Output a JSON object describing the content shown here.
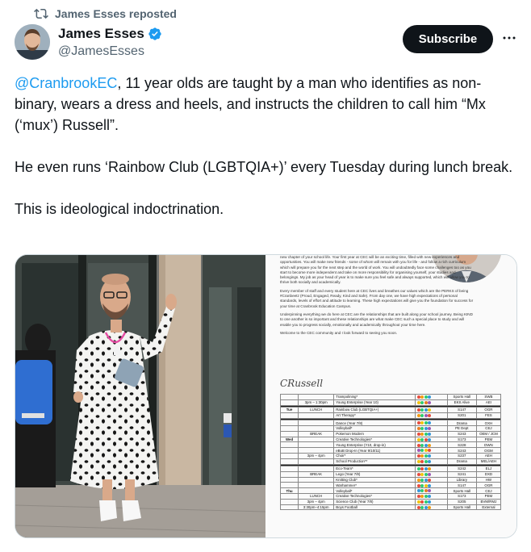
{
  "repost": {
    "text": "James Esses reposted"
  },
  "author": {
    "name": "James Esses",
    "handle": "@JamesEsses"
  },
  "actions": {
    "subscribe_label": "Subscribe"
  },
  "tweet": {
    "p1_mention": "@CranbrookEC",
    "p1_rest": ", 11 year olds are taught by a man who identifies as non-binary, wears a dress and heels, and instructs the children to call him “Mx (‘mux’) Russell”.",
    "p2": "He even runs ‘Rainbow Club (LGBTQIA+)’ every Tuesday during lunch break.",
    "p3": "This is ideological indoctrination."
  },
  "document": {
    "para1": "new chapter of your school life. Your first year at CEC will be an exciting time, filled with new experiences and opportunities. You will make new friends - some of whom will remain with you for life - and follow a rich curriculum which will prepare you for the next step and the world of work. You will undoubtedly face some challenges too as you start to become more independent and take on more responsibility for organising yourself, your studies and belongings. My job as your head of year is to make sure you feel safe and always supported, which will allow you to thrive both socially and academically.",
    "para2": "Every member of staff and every student here at CEC lives and breathes our values which are the PERKS of being #Cranbeetz (Proud, Engaged, Ready, Kind and Safe). From day one, we have high expectations of personal standards, levels of effort and attitude to learning. These high expectations will give you the foundation for success for your time at Cranbrook Education Campus.",
    "para3": "Underpinning everything we do here at CEC are the relationships that are built along your school journey. Being KIND to one another is so important and these relationships are what make CEC such a special place to study and will enable you to progress socially, emotionally and academically throughout your time here.",
    "para4": "Welcome to the CEC community and I look forward to seeing you soon.",
    "signature": "CRussell"
  },
  "schedule": {
    "rows": [
      {
        "day": "",
        "time": "",
        "activity": "Trampolining*",
        "location": "Sports Hall",
        "code": "SWB",
        "dots": [
          "#e74c3c",
          "#f39c12",
          "#2ecc71",
          "#3498db"
        ]
      },
      {
        "day": "",
        "time": "3pm – 1:30pm",
        "activity": "Young Enterprise (Year 10)",
        "location": "EKS Alive",
        "code": "AEI",
        "dots": [
          "#f1c40f",
          "#2ecc71",
          "#e67e22",
          "#9b59b6"
        ]
      },
      {
        "band": true
      },
      {
        "day": "Tue",
        "time": "LUNCH",
        "activity": "Rainbow Club (LGBTQIA+)",
        "location": "S147",
        "code": "OGR",
        "dots": [
          "#e74c3c",
          "#2ecc71",
          "#3498db",
          "#f1c40f"
        ]
      },
      {
        "day": "",
        "time": "",
        "activity": "Art Therapy*",
        "location": "S201",
        "code": "FES",
        "dots": [
          "#f39c12",
          "#2ecc71",
          "#9b59b6",
          "#e74c3c"
        ]
      },
      {
        "band": true
      },
      {
        "day": "",
        "time": "",
        "activity": "Dance (Year 7/8)",
        "location": "Drama",
        "code": "OXH",
        "dots": [
          "#e74c3c",
          "#f1c40f",
          "#2ecc71",
          "#3498db"
        ]
      },
      {
        "day": "",
        "time": "",
        "activity": "Volleyball*",
        "location": "PE Dept",
        "code": "CEJ",
        "dots": [
          "#e67e22",
          "#2ecc71",
          "#3498db",
          "#9b59b6"
        ]
      },
      {
        "day": "",
        "time": "BREAK",
        "activity": "Pokemon Modern",
        "location": "S243",
        "code": "OEM / JCM",
        "dots": [
          "#e74c3c",
          "#f39c12",
          "#2ecc71",
          "#3498db"
        ]
      },
      {
        "day": "Wed",
        "time": "",
        "activity": "Creative Technologies*",
        "location": "S173",
        "code": "PEM",
        "dots": [
          "#f1c40f",
          "#2ecc71",
          "#e74c3c",
          "#3498db"
        ]
      },
      {
        "day": "",
        "time": "",
        "activity": "Young Enterprise (Y10, drop-in)",
        "location": "S228",
        "code": "DWN",
        "dots": [
          "#e74c3c",
          "#2ecc71",
          "#3498db",
          "#f39c12"
        ]
      },
      {
        "day": "",
        "time": "",
        "activity": "eBoB Drop-In (Year 9/10/11)",
        "location": "S243",
        "code": "OGM",
        "dots": [
          "#9b59b6",
          "#2ecc71",
          "#f1c40f",
          "#e74c3c"
        ]
      },
      {
        "day": "",
        "time": "3pm – 4pm",
        "activity": "Choir*",
        "location": "S237",
        "code": "AEH",
        "dots": [
          "#e74c3c",
          "#f39c12",
          "#2ecc71",
          "#3498db"
        ]
      },
      {
        "day": "",
        "time": "",
        "activity": "School Production**",
        "location": "Drama",
        "code": "MEL/AEH",
        "dots": [
          "#f1c40f",
          "#e74c3c",
          "#2ecc71",
          "#3498db"
        ]
      },
      {
        "band": true
      },
      {
        "day": "",
        "time": "",
        "activity": "Eco-Team*",
        "location": "S242",
        "code": "ELJ",
        "dots": [
          "#2ecc71",
          "#e74c3c",
          "#3498db",
          "#f39c12"
        ]
      },
      {
        "day": "",
        "time": "BREAK",
        "activity": "Lego (Year 7/8)",
        "location": "S241",
        "code": "DXD",
        "dots": [
          "#e74c3c",
          "#f1c40f",
          "#2ecc71",
          "#9b59b6"
        ]
      },
      {
        "day": "",
        "time": "",
        "activity": "Knitting Club*",
        "location": "Library",
        "code": "HW",
        "dots": [
          "#f39c12",
          "#2ecc71",
          "#3498db",
          "#e74c3c"
        ]
      },
      {
        "day": "",
        "time": "",
        "activity": "Warhammer*",
        "location": "S147",
        "code": "OGR",
        "dots": [
          "#e74c3c",
          "#2ecc71",
          "#f1c40f",
          "#3498db"
        ]
      },
      {
        "day": "Thu",
        "time": "",
        "activity": "Volleyball*",
        "location": "Sports Hall",
        "code": "CEJ",
        "dots": [
          "#3498db",
          "#2ecc71",
          "#e67e22",
          "#9b59b6"
        ]
      },
      {
        "day": "",
        "time": "LUNCH",
        "activity": "Creative Technologies*",
        "location": "S173",
        "code": "PEM",
        "dots": [
          "#e74c3c",
          "#f39c12",
          "#2ecc71",
          "#3498db"
        ]
      },
      {
        "day": "",
        "time": "3pm – 4pm",
        "activity": "Science Club (Year 7/8)",
        "location": "S205",
        "code": "BVM/RMJ",
        "dots": [
          "#f1c40f",
          "#e74c3c",
          "#2ecc71",
          "#3498db"
        ]
      },
      {
        "day": "",
        "time": "3:30pm–4:15pm",
        "activity": "Boys Football",
        "location": "Sports Hall",
        "code": "External",
        "dots": [
          "#e74c3c",
          "#2ecc71",
          "#3498db",
          "#f39c12"
        ]
      }
    ]
  },
  "icons": {
    "repost": "repost-icon",
    "verified": "verified-badge-icon",
    "more": "more-options-icon"
  },
  "colors": {
    "link": "#1d9bf0",
    "secondary_text": "#536471",
    "button_bg": "#0f1419",
    "verified": "#1d9bf0"
  }
}
